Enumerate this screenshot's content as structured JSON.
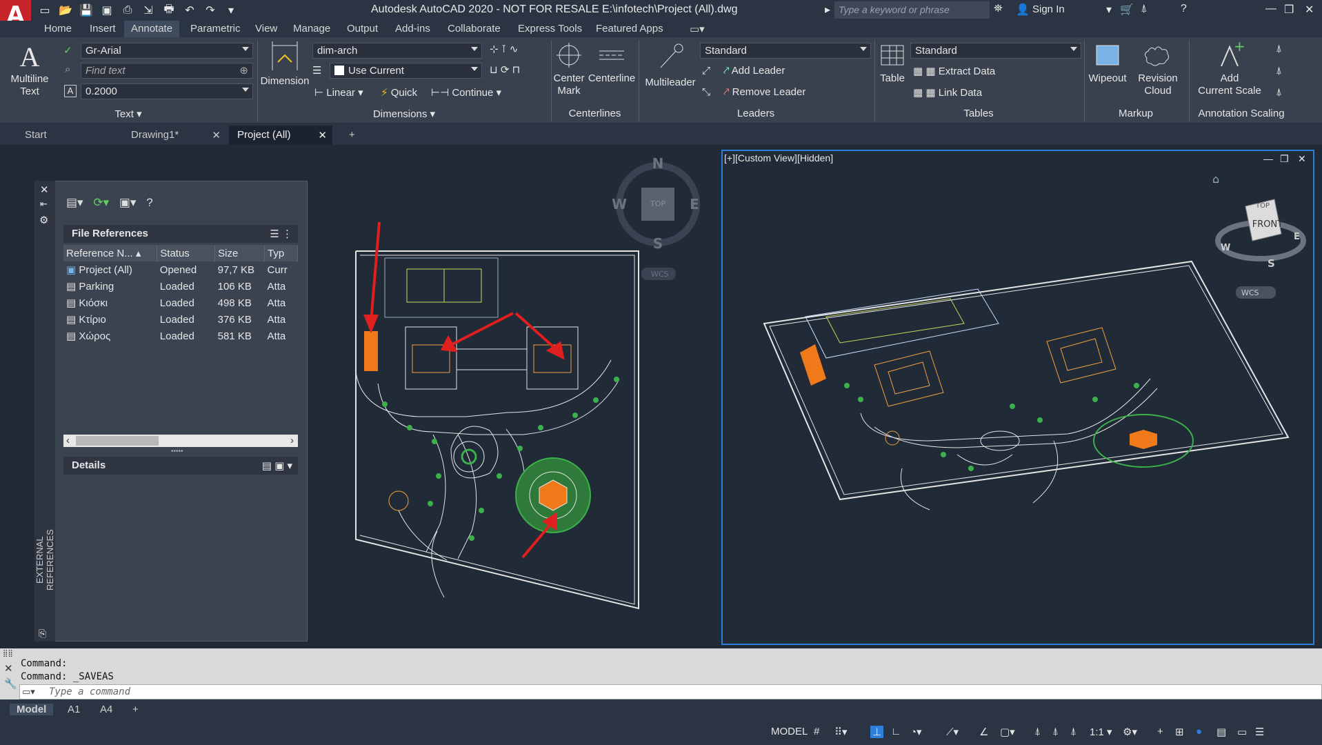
{
  "app": {
    "logo": "A",
    "title": "Autodesk AutoCAD 2020 - NOT FOR RESALE    E:\\infotech\\Project (All).dwg",
    "search_placeholder": "Type a keyword or phrase",
    "sign_in": "Sign In"
  },
  "menus": [
    "Home",
    "Insert",
    "Annotate",
    "Parametric",
    "View",
    "Manage",
    "Output",
    "Add-ins",
    "Collaborate",
    "Express Tools",
    "Featured Apps"
  ],
  "ribbon": {
    "text": {
      "multiline": "Multiline",
      "multiline2": "Text",
      "font": "Gr-Arial",
      "find": "Find text",
      "height": "0.2000",
      "panel": "Text"
    },
    "dimensions": {
      "dimension": "Dimension",
      "style": "dim-arch",
      "layer": "Use Current",
      "linear": "Linear",
      "quick": "Quick",
      "continue": "Continue",
      "panel": "Dimensions"
    },
    "centerlines": {
      "center_mark": "Center",
      "center_mark2": "Mark",
      "centerline": "Centerline",
      "panel": "Centerlines"
    },
    "leaders": {
      "multileader": "Multileader",
      "style": "Standard",
      "add": "Add Leader",
      "remove": "Remove Leader",
      "panel": "Leaders"
    },
    "tables": {
      "table": "Table",
      "style": "Standard",
      "extract": "Extract Data",
      "link": "Link Data",
      "panel": "Tables"
    },
    "markup": {
      "wipeout": "Wipeout",
      "revision": "Revision",
      "revision2": "Cloud",
      "panel": "Markup"
    },
    "scaling": {
      "add": "Add",
      "add2": "Current Scale",
      "panel": "Annotation Scaling"
    }
  },
  "doctabs": [
    "Start",
    "Drawing1*",
    "Project (All)"
  ],
  "xref": {
    "side_label": "EXTERNAL REFERENCES",
    "file_refs": "File References",
    "columns": [
      "Reference N...",
      "Status",
      "Size",
      "Typ"
    ],
    "rows": [
      [
        "Project (All)",
        "Opened",
        "97,7 KB",
        "Curr"
      ],
      [
        "Parking",
        "Loaded",
        "106 KB",
        "Atta"
      ],
      [
        "Κιόσκι",
        "Loaded",
        "498 KB",
        "Atta"
      ],
      [
        "Κτίριο",
        "Loaded",
        "376 KB",
        "Atta"
      ],
      [
        "Χώρος",
        "Loaded",
        "581 KB",
        "Atta"
      ]
    ],
    "details": "Details"
  },
  "viewcube_left": {
    "n": "N",
    "s": "S",
    "e": "E",
    "w": "W",
    "top": "TOP",
    "wcs": "WCS"
  },
  "viewport_right": {
    "label": "[+][Custom View][Hidden]",
    "top": "TOP",
    "front": "FRONT",
    "wcs": "WCS",
    "w": "W",
    "s": "S",
    "e": "E"
  },
  "command": {
    "line1": "Command:",
    "line2": "Command: _SAVEAS",
    "placeholder": "Type a command"
  },
  "layouts": [
    "Model",
    "A1",
    "A4"
  ],
  "status": {
    "model": "MODEL",
    "scale": "1:1"
  },
  "colors": {
    "accent": "#2c7fdb",
    "orange": "#f07a1a",
    "green": "#3cb04a",
    "arrow": "#e01f1f"
  }
}
